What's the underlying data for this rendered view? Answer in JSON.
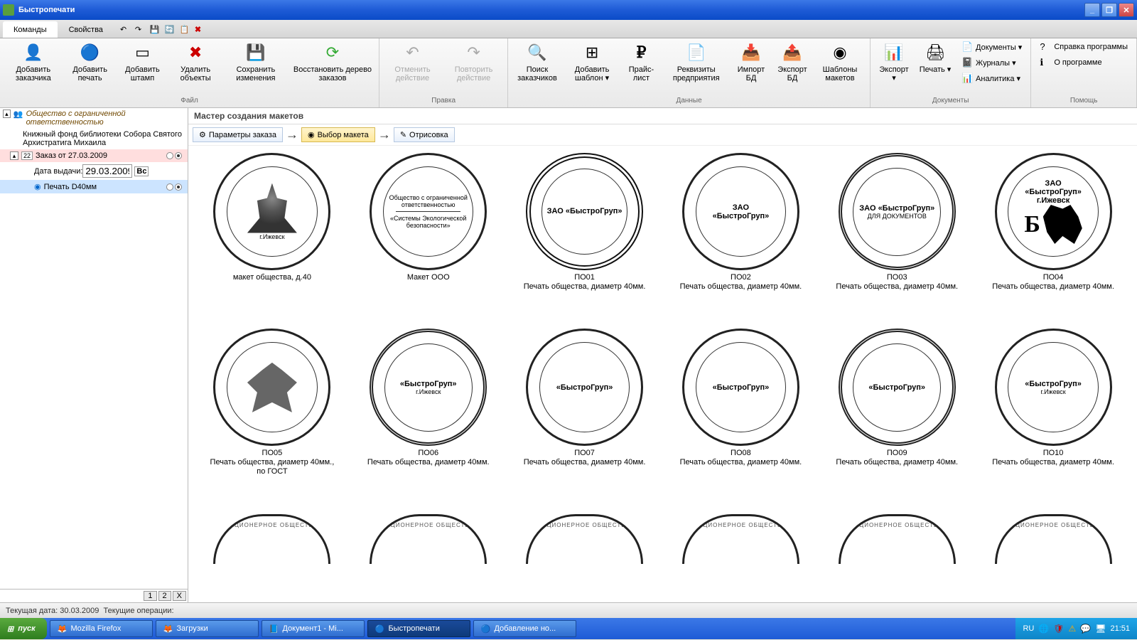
{
  "title": "Быстропечати",
  "tabs": {
    "cmd": "Команды",
    "prop": "Свойства"
  },
  "ribbon": {
    "groups": {
      "file": {
        "label": "Файл",
        "items": [
          {
            "label": "Добавить\nзаказчика"
          },
          {
            "label": "Добавить\nпечать"
          },
          {
            "label": "Добавить\nштамп"
          },
          {
            "label": "Удалить\nобъекты"
          },
          {
            "label": "Сохранить\nизменения"
          },
          {
            "label": "Восстановить\nдерево заказов"
          }
        ]
      },
      "edit": {
        "label": "Правка",
        "items": [
          {
            "label": "Отменить\nдействие"
          },
          {
            "label": "Повторить\nдействие"
          }
        ]
      },
      "data": {
        "label": "Данные",
        "items": [
          {
            "label": "Поиск\nзаказчиков"
          },
          {
            "label": "Добавить\nшаблон ▾"
          },
          {
            "label": "Прайс-\nлист"
          },
          {
            "label": "Реквизиты\nпредприятия"
          },
          {
            "label": "Импорт\nБД"
          },
          {
            "label": "Экспорт\nБД"
          },
          {
            "label": "Шаблоны\nмакетов"
          }
        ]
      },
      "docs": {
        "label": "Документы",
        "big": [
          {
            "label": "Экспорт\n▾"
          },
          {
            "label": "Печать\n▾"
          }
        ],
        "small": [
          {
            "label": "Документы ▾"
          },
          {
            "label": "Журналы ▾"
          },
          {
            "label": "Аналитика ▾"
          }
        ]
      },
      "help": {
        "label": "Помощь",
        "small": [
          {
            "label": "Справка программы"
          },
          {
            "label": "О программе"
          }
        ]
      }
    }
  },
  "tree": {
    "root": "Общество с ограниченной ответственностью",
    "sub": "Книжный фонд библиотеки Собора Святого Архистратига Михаила",
    "order": "Заказ от 27.03.2009",
    "date_label": "Дата выдачи:",
    "date_value": "29.03.2009",
    "vs_label": "Вс",
    "stamp_item": "Печать D40мм"
  },
  "sidebar_tabs": {
    "t1": "1",
    "t2": "2",
    "tx": "X"
  },
  "content": {
    "title": "Мастер создания макетов",
    "steps": {
      "s1": "Параметры заказа",
      "s2": "Выбор макета",
      "s3": "Отрисовка"
    }
  },
  "stamps": [
    {
      "code": "",
      "name": "макет общества, д.40",
      "desc": "",
      "center": "",
      "sub": "г.Ижевск",
      "style": "church"
    },
    {
      "code": "",
      "name": "Макет ООО",
      "desc": "",
      "center": "",
      "sub": "",
      "style": "ooo"
    },
    {
      "code": "ПО01",
      "name": "",
      "desc": "Печать общества, диаметр 40мм.",
      "center": "ЗАО «БыстроГруп»",
      "sub": "",
      "style": "thick"
    },
    {
      "code": "ПО02",
      "name": "",
      "desc": "Печать общества, диаметр 40мм.",
      "center": "ЗАО\n«БыстроГруп»",
      "sub": "",
      "style": "thin"
    },
    {
      "code": "ПО03",
      "name": "",
      "desc": "Печать общества, диаметр 40мм.",
      "center": "ЗАО «БыстроГруп»",
      "sub": "ДЛЯ ДОКУМЕНТОВ",
      "style": "dbl"
    },
    {
      "code": "ПО04",
      "name": "",
      "desc": "Печать общества, диаметр 40мм.",
      "center": "ЗАО\n«БыстроГруп»\nг.Ижевск",
      "sub": "",
      "style": "lion"
    },
    {
      "code": "ПО05",
      "name": "",
      "desc": "Печать общества, диаметр 40мм., по ГОСТ",
      "center": "",
      "sub": "",
      "style": "eagle"
    },
    {
      "code": "ПО06",
      "name": "",
      "desc": "Печать общества, диаметр 40мм.",
      "center": "«БыстроГруп»",
      "sub": "г.Ижевск",
      "style": "rope"
    },
    {
      "code": "ПО07",
      "name": "",
      "desc": "Печать общества, диаметр 40мм.",
      "center": "«БыстроГруп»",
      "sub": "",
      "style": "thin"
    },
    {
      "code": "ПО08",
      "name": "",
      "desc": "Печать общества, диаметр 40мм.",
      "center": "«БыстроГруп»",
      "sub": "",
      "style": "thin"
    },
    {
      "code": "ПО09",
      "name": "",
      "desc": "Печать общества, диаметр 40мм.",
      "center": "«БыстроГруп»",
      "sub": "",
      "style": "dbl"
    },
    {
      "code": "ПО10",
      "name": "",
      "desc": "Печать общества, диаметр 40мм.",
      "center": "«БыстроГруп»",
      "sub": "г.Ижевск",
      "style": "thin"
    }
  ],
  "status": {
    "date_label": "Текущая дата:",
    "date_value": "30.03.2009",
    "ops_label": "Текущие операции:"
  },
  "taskbar": {
    "start": "пуск",
    "tasks": [
      {
        "label": "Mozilla Firefox"
      },
      {
        "label": "Загрузки"
      },
      {
        "label": "Документ1 - Mi..."
      },
      {
        "label": "Быстропечати",
        "active": true
      },
      {
        "label": "Добавление но..."
      }
    ],
    "lang": "RU",
    "time": "21:51"
  }
}
